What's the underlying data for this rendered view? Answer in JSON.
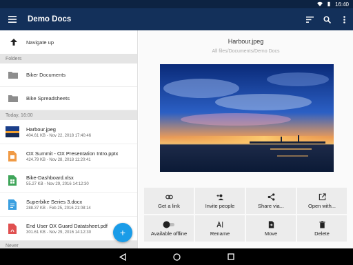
{
  "status": {
    "time": "16:40"
  },
  "app_bar": {
    "title": "Demo Docs"
  },
  "left": {
    "navigate_up": "Navigate up",
    "sections": {
      "folders": "Folders",
      "today": "Today, 16:00",
      "never": "Never"
    },
    "folders": [
      {
        "name": "Biker Documents"
      },
      {
        "name": "Bike Spreadsheets"
      }
    ],
    "files": [
      {
        "name": "Harbour.jpeg",
        "meta": "404.61 KB - Nov 22, 2018 17:40:46",
        "icon": "image-thumbnail",
        "color": "#f0a030"
      },
      {
        "name": "OX Summit - OX Presentation Intro.pptx",
        "meta": "424.79 KB - Nov 28, 2018 11:20:41",
        "icon": "presentation-icon",
        "color": "#f09a45"
      },
      {
        "name": "Bike-Dashboard.xlsx",
        "meta": "55.27 KB - Nov 29, 2016 14:12:30",
        "icon": "spreadsheet-icon",
        "color": "#3fa55a"
      },
      {
        "name": "Superbike Series 3.docx",
        "meta": "288.37 KB - Feb 25, 2016 21:08:14",
        "icon": "document-icon",
        "color": "#3a9fe0"
      },
      {
        "name": "End User OX Guard Datatsheet.pdf",
        "meta": "301.61 KB - Nov 29, 2016 14:12:30",
        "icon": "pdf-icon",
        "color": "#e05050"
      }
    ]
  },
  "detail": {
    "title": "Harbour.jpeg",
    "path": "All files/Documents/Demo Docs",
    "actions": [
      {
        "label": "Get a link",
        "icon": "link-icon"
      },
      {
        "label": "Invite people",
        "icon": "person-add-icon"
      },
      {
        "label": "Share via...",
        "icon": "share-icon"
      },
      {
        "label": "Open with...",
        "icon": "open-external-icon"
      },
      {
        "label": "Available offline",
        "icon": "toggle-icon"
      },
      {
        "label": "Rename",
        "icon": "rename-icon"
      },
      {
        "label": "Move",
        "icon": "move-file-icon"
      },
      {
        "label": "Delete",
        "icon": "trash-icon"
      }
    ]
  },
  "colors": {
    "app_bar": "#13305a",
    "status_bar": "#0d2342",
    "fab": "#1a9ce8"
  }
}
